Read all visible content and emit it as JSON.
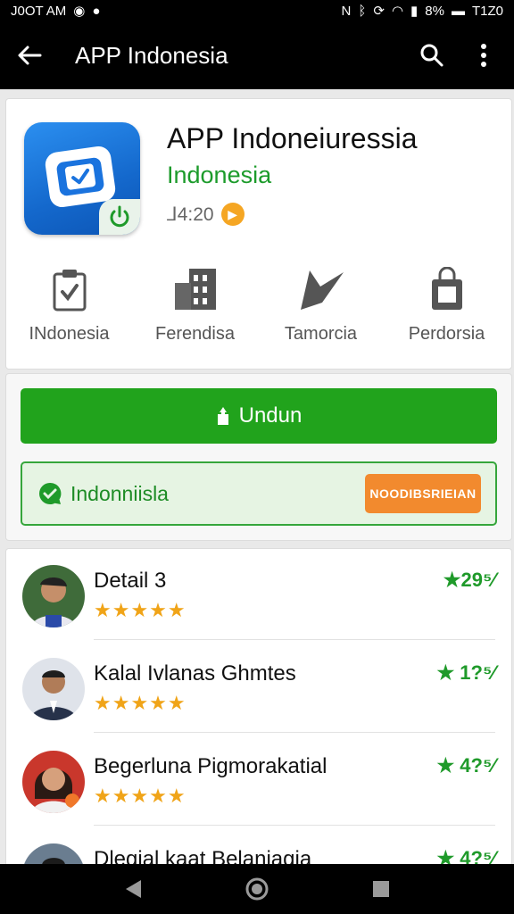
{
  "status_bar": {
    "time": "J0OT AM",
    "battery_pct": "8%",
    "clock_right": "T1Z0"
  },
  "app_bar": {
    "title": "APP Indonesia"
  },
  "app": {
    "title": "APP Indoneiuressia",
    "developer": "Indonesia",
    "meta": "⅃4:20"
  },
  "categories": [
    {
      "label": "INdonesia",
      "icon": "document-check-icon"
    },
    {
      "label": "Ferendisa",
      "icon": "building-icon"
    },
    {
      "label": "Tamorcia",
      "icon": "pen-icon"
    },
    {
      "label": "Perdorsia",
      "icon": "bag-icon"
    }
  ],
  "actions": {
    "install_label": "Undun",
    "promo_text": "Indonniisla",
    "promo_button": "NOODIBSRIEIAN"
  },
  "reviews": [
    {
      "name": "Detail 3",
      "stars": "★★★★★",
      "score": "★29⁵⁄"
    },
    {
      "name": "Kalal Ivlanas Ghmtes",
      "stars": "★★★★★",
      "score": "★ 1?⁵⁄"
    },
    {
      "name": "Begerluna Pigmorakatial",
      "stars": "★★★★★",
      "score": "★ 4?⁵⁄"
    },
    {
      "name": "Dlegial kaat Belaniagia",
      "stars": "★★★★★",
      "score": "★ 4?⁵⁄"
    }
  ],
  "colors": {
    "accent": "#21a31c",
    "promo_button": "#f28a2e",
    "star": "#f0a418"
  }
}
